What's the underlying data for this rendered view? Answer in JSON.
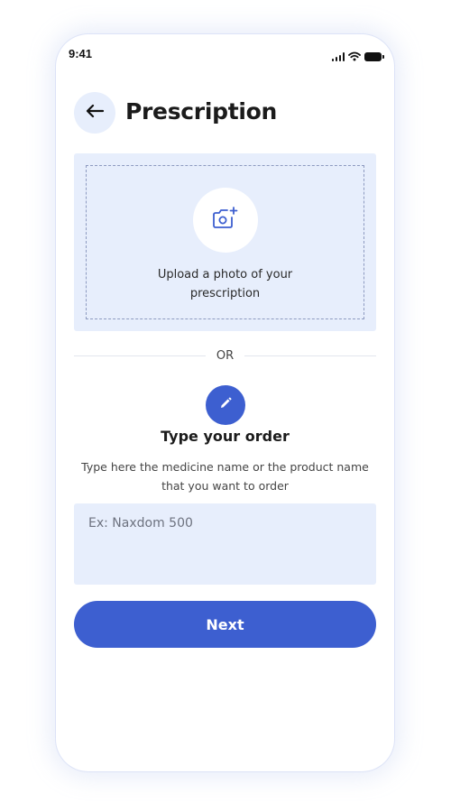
{
  "status_bar": {
    "time": "9:41"
  },
  "header": {
    "title": "Prescription",
    "back_icon": "arrow-left-icon"
  },
  "upload": {
    "label": "Upload a photo of your prescription",
    "icon": "camera-plus-icon"
  },
  "divider": {
    "label": "OR"
  },
  "type_order": {
    "icon": "pencil-icon",
    "title": "Type your order",
    "description": "Type here the medicine name or the product name that you want to order",
    "input_placeholder": "Ex: Naxdom 500",
    "input_value": ""
  },
  "next_button": {
    "label": "Next"
  },
  "colors": {
    "accent": "#3d5fd0",
    "card_bg": "#e7eefc",
    "title_text": "#1b1b1b"
  }
}
